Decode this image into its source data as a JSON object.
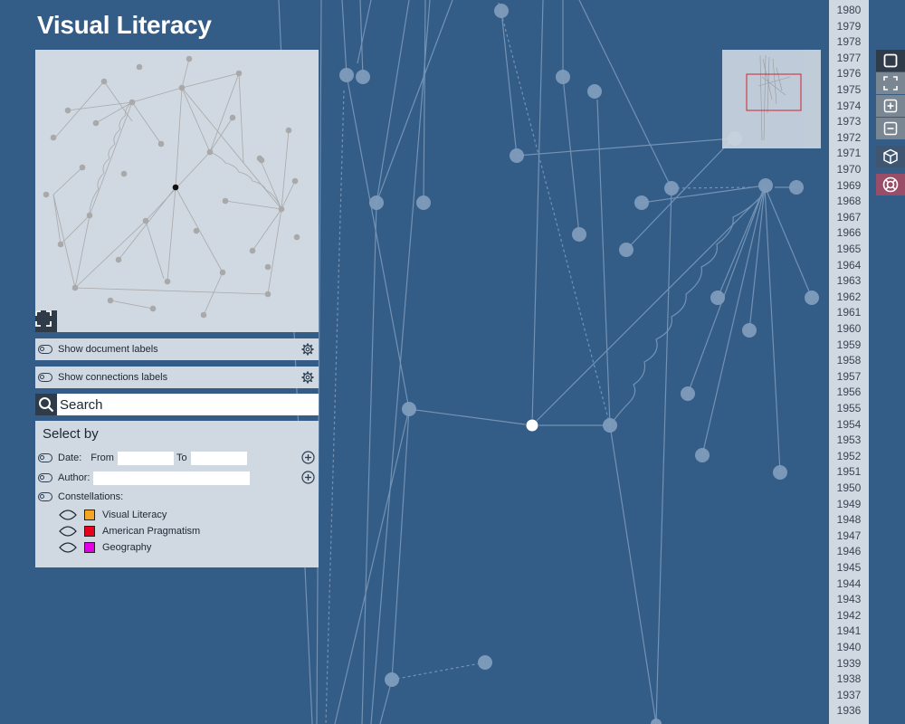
{
  "app": {
    "title": "Visual Literacy"
  },
  "overview": {
    "expand_icon": "expand-icon"
  },
  "toggles": {
    "document_labels": "Show document labels",
    "connection_labels": "Show connections labels"
  },
  "search": {
    "placeholder": "Search",
    "value": ""
  },
  "select_by": {
    "title": "Select by",
    "date_label": "Date:",
    "from_label": "From",
    "to_label": "To",
    "from_value": "",
    "to_value": "",
    "author_label": "Author:",
    "author_value": "",
    "constellations_label": "Constellations:",
    "constellations": [
      {
        "name": "Visual Literacy",
        "color": "#f5a623"
      },
      {
        "name": "American Pragmatism",
        "color": "#e8001c"
      },
      {
        "name": "Geography",
        "color": "#e400e4"
      }
    ]
  },
  "timeline": {
    "years": [
      "1980",
      "1979",
      "1978",
      "1977",
      "1976",
      "1975",
      "1974",
      "1973",
      "1972",
      "1971",
      "1970",
      "1969",
      "1968",
      "1967",
      "1966",
      "1965",
      "1964",
      "1963",
      "1962",
      "1961",
      "1960",
      "1959",
      "1958",
      "1957",
      "1956",
      "1955",
      "1954",
      "1953",
      "1952",
      "1951",
      "1950",
      "1949",
      "1948",
      "1947",
      "1946",
      "1945",
      "1944",
      "1943",
      "1942",
      "1941",
      "1940",
      "1939",
      "1938",
      "1937",
      "1936"
    ]
  },
  "tools": [
    "select-mode-icon",
    "fit-view-icon",
    "zoom-in-icon",
    "zoom-out-icon",
    "3d-view-icon",
    "help-icon"
  ],
  "colors": {
    "background": "#335c87",
    "panel": "#d0d8e2",
    "node": "#8fa6c0",
    "selected_node": "#ffffff",
    "help_button": "#9a4d66",
    "minimap_viewport": "#e02020"
  }
}
